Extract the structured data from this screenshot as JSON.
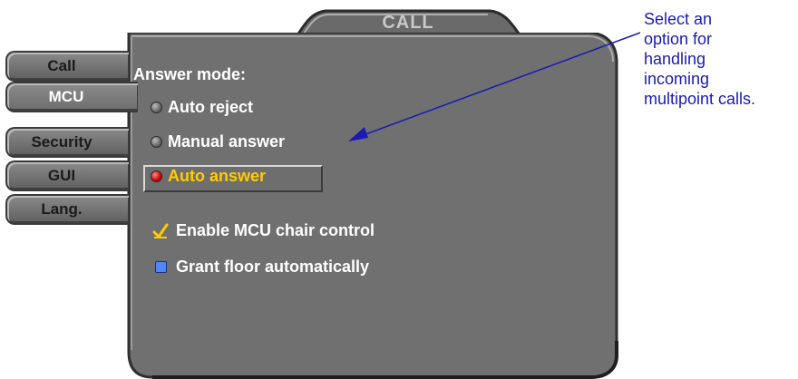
{
  "window": {
    "title": "CALL"
  },
  "side_tabs": [
    {
      "label": "Call"
    },
    {
      "label": "MCU"
    },
    {
      "label": "Security"
    },
    {
      "label": "GUI"
    },
    {
      "label": "Lang."
    }
  ],
  "active_tab": "MCU",
  "answer_mode": {
    "heading": "Answer mode:",
    "options": [
      {
        "label": "Auto reject",
        "selected": false
      },
      {
        "label": "Manual answer",
        "selected": false
      },
      {
        "label": "Auto answer",
        "selected": true
      }
    ]
  },
  "options": {
    "chair_control": {
      "label": "Enable MCU chair control",
      "checked": true
    },
    "grant_floor": {
      "label": "Grant floor automatically",
      "checked": false
    }
  },
  "callout": {
    "lines": [
      "Select an",
      "option for",
      "handling",
      "incoming",
      "multipoint calls."
    ]
  },
  "colors": {
    "panel": "#6f6f6f",
    "selected_text": "#ffcc00",
    "callout_text": "#1a1ab5",
    "arrow": "#1a1ab5"
  }
}
